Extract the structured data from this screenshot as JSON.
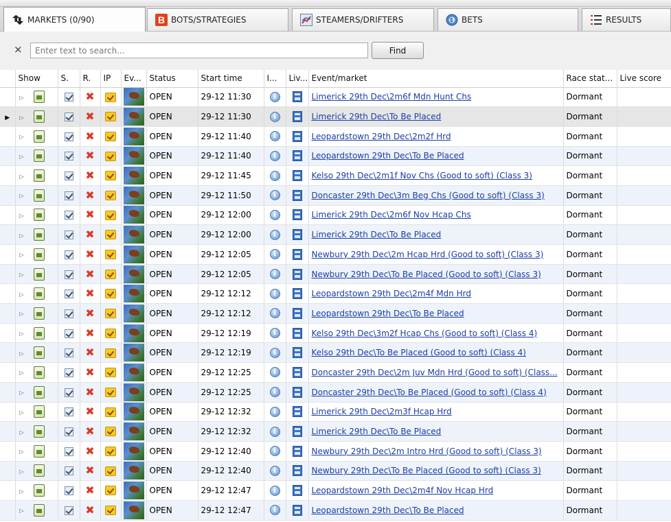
{
  "tabs": [
    {
      "label": "MARKETS (0/90)",
      "icon": "markets-icon",
      "active": true
    },
    {
      "label": "BOTS/STRATEGIES",
      "icon": "bots-icon",
      "active": false
    },
    {
      "label": "STEAMERS/DRIFTERS",
      "icon": "steamers-icon",
      "active": false
    },
    {
      "label": "BETS",
      "icon": "bets-icon",
      "active": false
    },
    {
      "label": "RESULTS",
      "icon": "results-icon",
      "active": false
    }
  ],
  "search": {
    "clear_symbol": "×",
    "placeholder": "Enter text to search...",
    "value": "",
    "find_label": "Find"
  },
  "columns": [
    "Show",
    "S.",
    "R.",
    "IP",
    "Ev...",
    "Status",
    "Start time",
    "I...",
    "Liv...",
    "Event/market",
    "Race stat...",
    "Live score"
  ],
  "rows": [
    {
      "status": "OPEN",
      "start": "29-12 11:30",
      "event": "Limerick 29th Dec\\2m6f Mdn Hunt Chs",
      "race_status": "Dormant"
    },
    {
      "status": "OPEN",
      "start": "29-12 11:30",
      "event": "Limerick 29th Dec\\To Be Placed",
      "race_status": "Dormant"
    },
    {
      "status": "OPEN",
      "start": "29-12 11:40",
      "event": "Leopardstown 29th Dec\\2m2f Hrd",
      "race_status": "Dormant"
    },
    {
      "status": "OPEN",
      "start": "29-12 11:40",
      "event": "Leopardstown 29th Dec\\To Be Placed",
      "race_status": "Dormant"
    },
    {
      "status": "OPEN",
      "start": "29-12 11:45",
      "event": "Kelso 29th Dec\\2m1f Nov Chs (Good to soft) (Class 3)",
      "race_status": "Dormant"
    },
    {
      "status": "OPEN",
      "start": "29-12 11:50",
      "event": "Doncaster 29th Dec\\3m Beg Chs (Good to soft) (Class 3)",
      "race_status": "Dormant"
    },
    {
      "status": "OPEN",
      "start": "29-12 12:00",
      "event": "Limerick 29th Dec\\2m6f Nov Hcap Chs",
      "race_status": "Dormant"
    },
    {
      "status": "OPEN",
      "start": "29-12 12:00",
      "event": "Limerick 29th Dec\\To Be Placed",
      "race_status": "Dormant"
    },
    {
      "status": "OPEN",
      "start": "29-12 12:05",
      "event": "Newbury 29th Dec\\2m Hcap Hrd (Good to soft) (Class 3)",
      "race_status": "Dormant"
    },
    {
      "status": "OPEN",
      "start": "29-12 12:05",
      "event": "Newbury 29th Dec\\To Be Placed (Good to soft) (Class 3)",
      "race_status": "Dormant"
    },
    {
      "status": "OPEN",
      "start": "29-12 12:12",
      "event": "Leopardstown 29th Dec\\2m4f Mdn Hrd",
      "race_status": "Dormant"
    },
    {
      "status": "OPEN",
      "start": "29-12 12:12",
      "event": "Leopardstown 29th Dec\\To Be Placed",
      "race_status": "Dormant"
    },
    {
      "status": "OPEN",
      "start": "29-12 12:19",
      "event": "Kelso 29th Dec\\3m2f Hcap Chs (Good to soft) (Class 4)",
      "race_status": "Dormant"
    },
    {
      "status": "OPEN",
      "start": "29-12 12:19",
      "event": "Kelso 29th Dec\\To Be Placed (Good to soft) (Class 4)",
      "race_status": "Dormant"
    },
    {
      "status": "OPEN",
      "start": "29-12 12:25",
      "event": "Doncaster 29th Dec\\2m Juv Mdn Hrd (Good to soft) (Class...",
      "race_status": "Dormant"
    },
    {
      "status": "OPEN",
      "start": "29-12 12:25",
      "event": "Doncaster 29th Dec\\To Be Placed (Good to soft) (Class 4)",
      "race_status": "Dormant"
    },
    {
      "status": "OPEN",
      "start": "29-12 12:32",
      "event": "Limerick 29th Dec\\2m3f Hcap Hrd",
      "race_status": "Dormant"
    },
    {
      "status": "OPEN",
      "start": "29-12 12:32",
      "event": "Limerick 29th Dec\\To Be Placed",
      "race_status": "Dormant"
    },
    {
      "status": "OPEN",
      "start": "29-12 12:40",
      "event": "Newbury 29th Dec\\2m Intro Hrd (Good to soft) (Class 3)",
      "race_status": "Dormant"
    },
    {
      "status": "OPEN",
      "start": "29-12 12:40",
      "event": "Newbury 29th Dec\\To Be Placed (Good to soft) (Class 3)",
      "race_status": "Dormant"
    },
    {
      "status": "OPEN",
      "start": "29-12 12:47",
      "event": "Leopardstown 29th Dec\\2m4f Nov Hcap Hrd",
      "race_status": "Dormant"
    },
    {
      "status": "OPEN",
      "start": "29-12 12:47",
      "event": "Leopardstown 29th Dec\\To Be Placed",
      "race_status": "Dormant"
    }
  ],
  "selected_row": 1,
  "colors": {
    "link": "#1a3ea6",
    "alt_row": "#eef3fb",
    "selected_row": "#e6e6e6"
  }
}
